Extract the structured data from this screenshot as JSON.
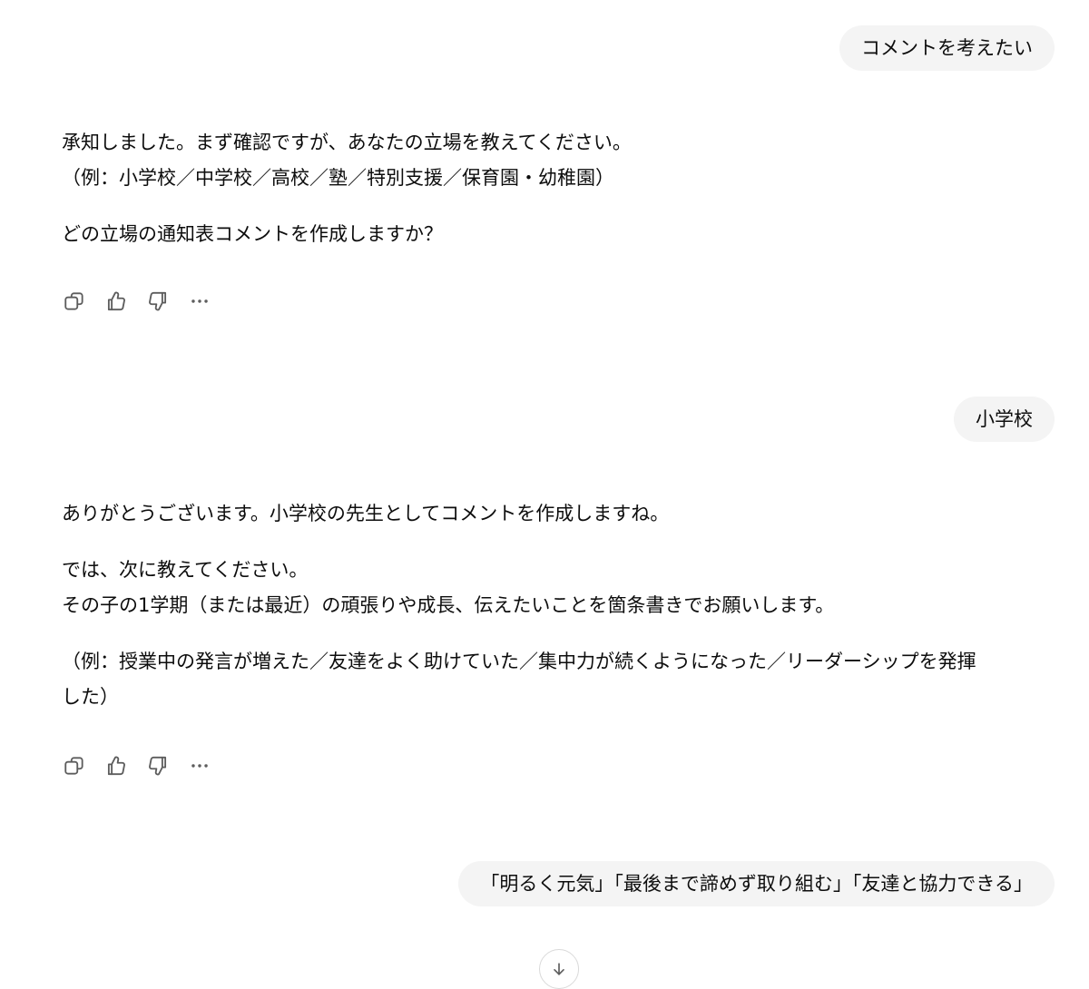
{
  "conversation": {
    "user_messages": [
      "コメントを考えたい",
      "小学校",
      "「明るく元気」「最後まで諦めず取り組む」「友達と協力できる」"
    ],
    "assistant_1": {
      "p1_line1": "承知しました。まず確認ですが、あなたの立場を教えてください。",
      "p1_line2": "（例：小学校／中学校／高校／塾／特別支援／保育園・幼稚園）",
      "p2": "どの立場の通知表コメントを作成しますか？"
    },
    "assistant_2": {
      "p1": "ありがとうございます。小学校の先生としてコメントを作成しますね。",
      "p2_line1": "では、次に教えてください。",
      "p2_line2": "その子の1学期（または最近）の頑張りや成長、伝えたいことを箇条書きでお願いします。",
      "p3_line1": "（例：授業中の発言が増えた／友達をよく助けていた／集中力が続くようになった／リーダーシップを発揮",
      "p3_line2": "した）"
    }
  },
  "icons": {
    "copy": "copy-icon",
    "like": "thumbs-up-icon",
    "dislike": "thumbs-down-icon",
    "more": "more-horizontal-icon",
    "scroll": "arrow-down-icon"
  },
  "colors": {
    "bubble_bg": "#f4f4f4",
    "text": "#0d0d0d",
    "icon": "#5d5d5d"
  }
}
